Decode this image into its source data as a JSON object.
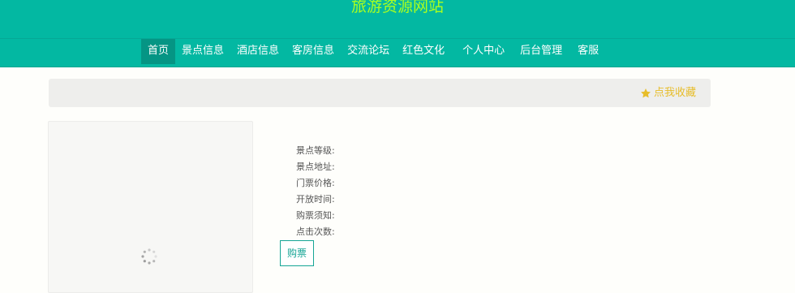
{
  "header": {
    "site_title": "旅游资源网站"
  },
  "nav": {
    "items": [
      {
        "label": "首页"
      },
      {
        "label": "景点信息"
      },
      {
        "label": "酒店信息"
      },
      {
        "label": "客房信息"
      },
      {
        "label": "交流论坛"
      },
      {
        "label": "红色文化"
      },
      {
        "label": "个人中心"
      },
      {
        "label": "后台管理"
      },
      {
        "label": "客服"
      }
    ]
  },
  "actions": {
    "collect_label": "点我收藏",
    "buy_label": "购票"
  },
  "details": {
    "level_label": "景点等级:",
    "address_label": "景点地址:",
    "price_label": "门票价格:",
    "open_time_label": "开放时间:",
    "notice_label": "购票须知:",
    "clicks_label": "点击次数:"
  },
  "icons": {
    "collect": "star-icon",
    "loading": "spinner-icon"
  },
  "colors": {
    "header_bg": "#03b8a2",
    "nav_active_bg": "#059584",
    "title_color": "#aaff1f",
    "collect_color": "#e7bd2a",
    "accent": "#16a595"
  }
}
